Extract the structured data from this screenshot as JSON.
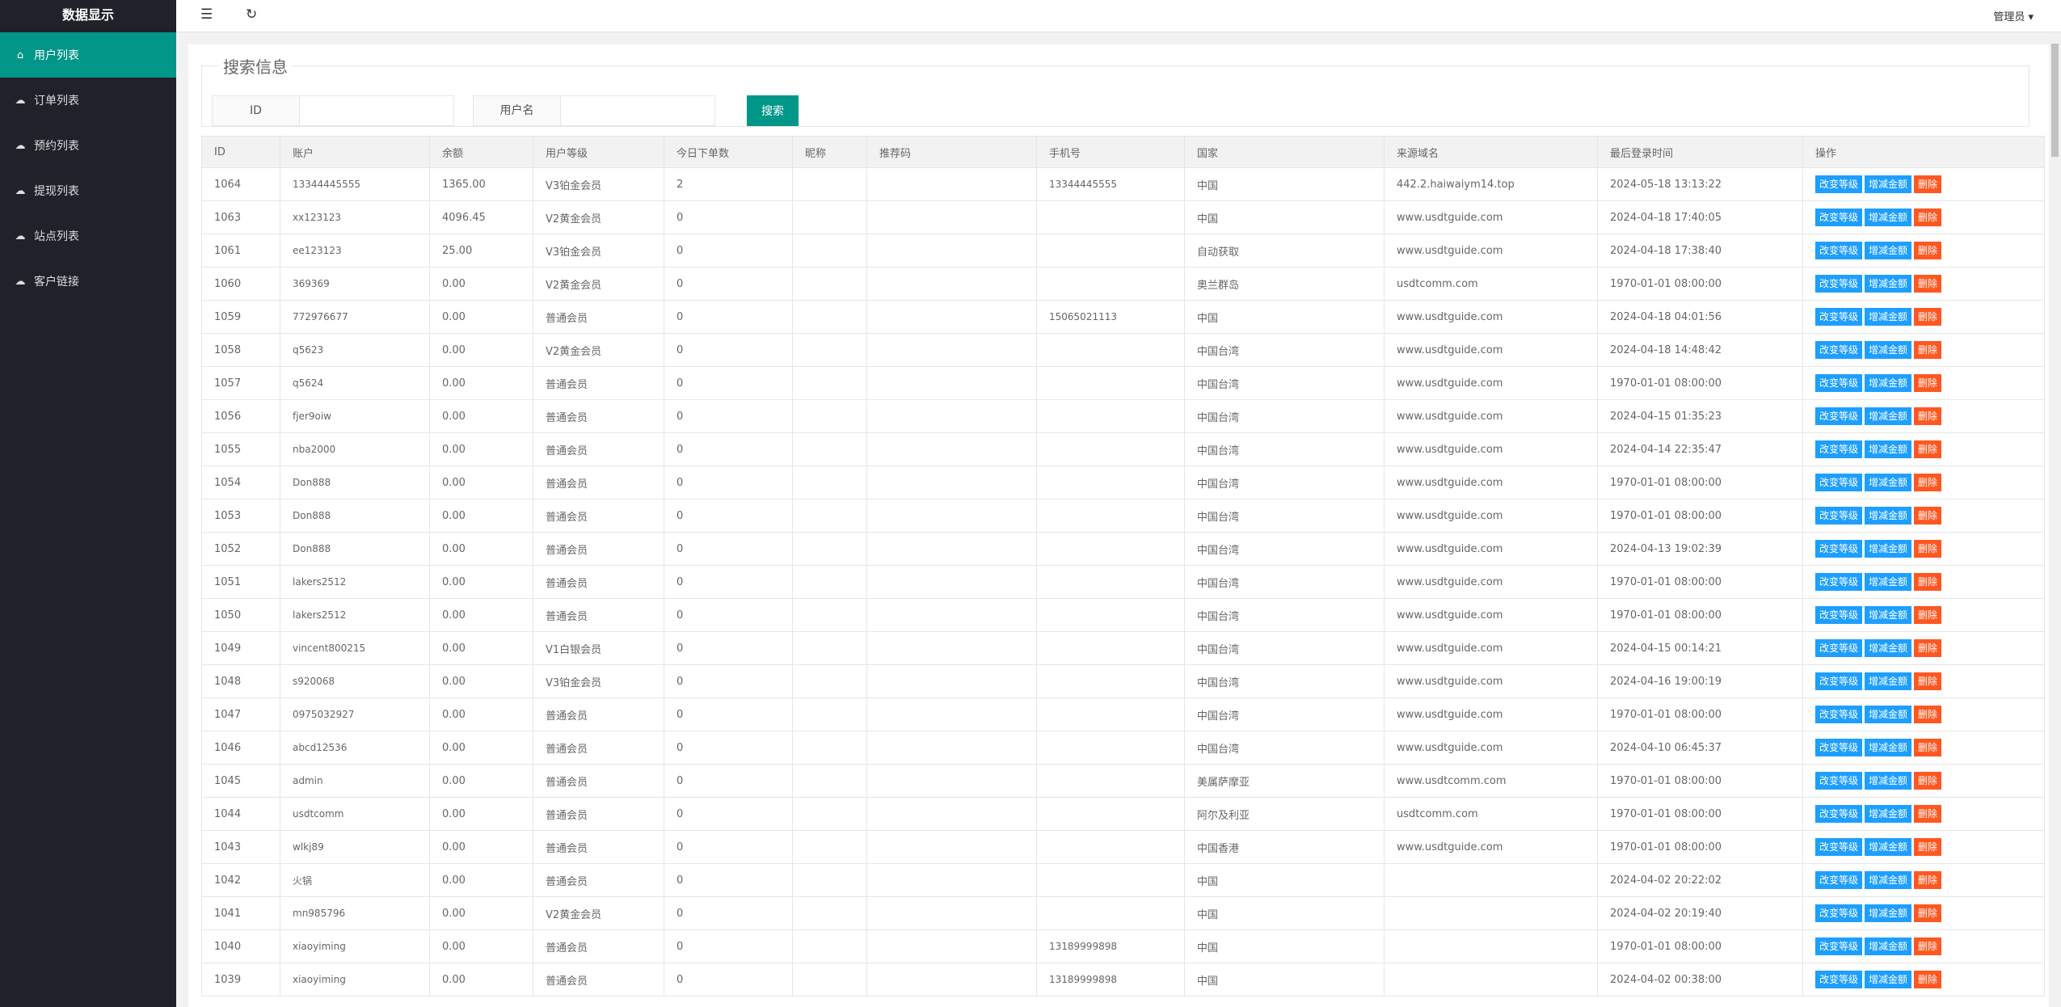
{
  "sidebar": {
    "logo": "数据显示",
    "items": [
      {
        "label": "用户列表",
        "icon": "home-icon"
      },
      {
        "label": "订单列表",
        "icon": "cloud-icon"
      },
      {
        "label": "预约列表",
        "icon": "cloud-icon"
      },
      {
        "label": "提现列表",
        "icon": "cloud-icon"
      },
      {
        "label": "站点列表",
        "icon": "cloud-icon"
      },
      {
        "label": "客户链接",
        "icon": "cloud-icon"
      }
    ]
  },
  "header": {
    "admin": "管理员 ▾"
  },
  "search": {
    "legend": "搜索信息",
    "id_label": "ID",
    "id_value": "",
    "user_label": "用户名",
    "user_value": "",
    "button": "搜索"
  },
  "table": {
    "columns": [
      "ID",
      "账户",
      "余额",
      "用户等级",
      "今日下单数",
      "昵称",
      "推荐码",
      "手机号",
      "国家",
      "来源域名",
      "最后登录时间",
      "操作"
    ],
    "actions": [
      "改变等级",
      "增减金额",
      "删除"
    ],
    "rows": [
      [
        "1064",
        "13344445555",
        "1365.00",
        "V3铂金会员",
        "2",
        "",
        "",
        "13344445555",
        "中国",
        "442.2.haiwaiym14.top",
        "2024-05-18 13:13:22"
      ],
      [
        "1063",
        "xx123123",
        "4096.45",
        "V2黄金会员",
        "0",
        "",
        "",
        "",
        "中国",
        "www.usdtguide.com",
        "2024-04-18 17:40:05"
      ],
      [
        "1061",
        "ee123123",
        "25.00",
        "V3铂金会员",
        "0",
        "",
        "",
        "",
        "自动获取",
        "www.usdtguide.com",
        "2024-04-18 17:38:40"
      ],
      [
        "1060",
        "369369",
        "0.00",
        "V2黄金会员",
        "0",
        "",
        "",
        "",
        "奥兰群岛",
        "usdtcomm.com",
        "1970-01-01 08:00:00"
      ],
      [
        "1059",
        "772976677",
        "0.00",
        "普通会员",
        "0",
        "",
        "",
        "15065021113",
        "中国",
        "www.usdtguide.com",
        "2024-04-18 04:01:56"
      ],
      [
        "1058",
        "q5623",
        "0.00",
        "V2黄金会员",
        "0",
        "",
        "",
        "",
        "中国台湾",
        "www.usdtguide.com",
        "2024-04-18 14:48:42"
      ],
      [
        "1057",
        "q5624",
        "0.00",
        "普通会员",
        "0",
        "",
        "",
        "",
        "中国台湾",
        "www.usdtguide.com",
        "1970-01-01 08:00:00"
      ],
      [
        "1056",
        "fjer9oiw",
        "0.00",
        "普通会员",
        "0",
        "",
        "",
        "",
        "中国台湾",
        "www.usdtguide.com",
        "2024-04-15 01:35:23"
      ],
      [
        "1055",
        "nba2000",
        "0.00",
        "普通会员",
        "0",
        "",
        "",
        "",
        "中国台湾",
        "www.usdtguide.com",
        "2024-04-14 22:35:47"
      ],
      [
        "1054",
        "Don888",
        "0.00",
        "普通会员",
        "0",
        "",
        "",
        "",
        "中国台湾",
        "www.usdtguide.com",
        "1970-01-01 08:00:00"
      ],
      [
        "1053",
        "Don888",
        "0.00",
        "普通会员",
        "0",
        "",
        "",
        "",
        "中国台湾",
        "www.usdtguide.com",
        "1970-01-01 08:00:00"
      ],
      [
        "1052",
        "Don888",
        "0.00",
        "普通会员",
        "0",
        "",
        "",
        "",
        "中国台湾",
        "www.usdtguide.com",
        "2024-04-13 19:02:39"
      ],
      [
        "1051",
        "lakers2512",
        "0.00",
        "普通会员",
        "0",
        "",
        "",
        "",
        "中国台湾",
        "www.usdtguide.com",
        "1970-01-01 08:00:00"
      ],
      [
        "1050",
        "lakers2512",
        "0.00",
        "普通会员",
        "0",
        "",
        "",
        "",
        "中国台湾",
        "www.usdtguide.com",
        "1970-01-01 08:00:00"
      ],
      [
        "1049",
        "vincent800215",
        "0.00",
        "V1白银会员",
        "0",
        "",
        "",
        "",
        "中国台湾",
        "www.usdtguide.com",
        "2024-04-15 00:14:21"
      ],
      [
        "1048",
        "s920068",
        "0.00",
        "V3铂金会员",
        "0",
        "",
        "",
        "",
        "中国台湾",
        "www.usdtguide.com",
        "2024-04-16 19:00:19"
      ],
      [
        "1047",
        "0975032927",
        "0.00",
        "普通会员",
        "0",
        "",
        "",
        "",
        "中国台湾",
        "www.usdtguide.com",
        "1970-01-01 08:00:00"
      ],
      [
        "1046",
        "abcd12536",
        "0.00",
        "普通会员",
        "0",
        "",
        "",
        "",
        "中国台湾",
        "www.usdtguide.com",
        "2024-04-10 06:45:37"
      ],
      [
        "1045",
        "admin",
        "0.00",
        "普通会员",
        "0",
        "",
        "",
        "",
        "美属萨摩亚",
        "www.usdtcomm.com",
        "1970-01-01 08:00:00"
      ],
      [
        "1044",
        "usdtcomm",
        "0.00",
        "普通会员",
        "0",
        "",
        "",
        "",
        "阿尔及利亚",
        "usdtcomm.com",
        "1970-01-01 08:00:00"
      ],
      [
        "1043",
        "wlkj89",
        "0.00",
        "普通会员",
        "0",
        "",
        "",
        "",
        "中国香港",
        "www.usdtguide.com",
        "1970-01-01 08:00:00"
      ],
      [
        "1042",
        "火锅",
        "0.00",
        "普通会员",
        "0",
        "",
        "",
        "",
        "中国",
        "",
        "2024-04-02 20:22:02"
      ],
      [
        "1041",
        "mn985796",
        "0.00",
        "V2黄金会员",
        "0",
        "",
        "",
        "",
        "中国",
        "",
        "2024-04-02 20:19:40"
      ],
      [
        "1040",
        "xiaoyiming",
        "0.00",
        "普通会员",
        "0",
        "",
        "",
        "13189999898",
        "中国",
        "",
        "1970-01-01 08:00:00"
      ],
      [
        "1039",
        "xiaoyiming",
        "0.00",
        "普通会员",
        "0",
        "",
        "",
        "13189999898",
        "中国",
        "",
        "2024-04-02 00:38:00"
      ]
    ]
  },
  "colors": {
    "sidebar": "#20222a",
    "accent": "#009688",
    "blue": "#1E9FFF",
    "danger": "#FF5722"
  }
}
